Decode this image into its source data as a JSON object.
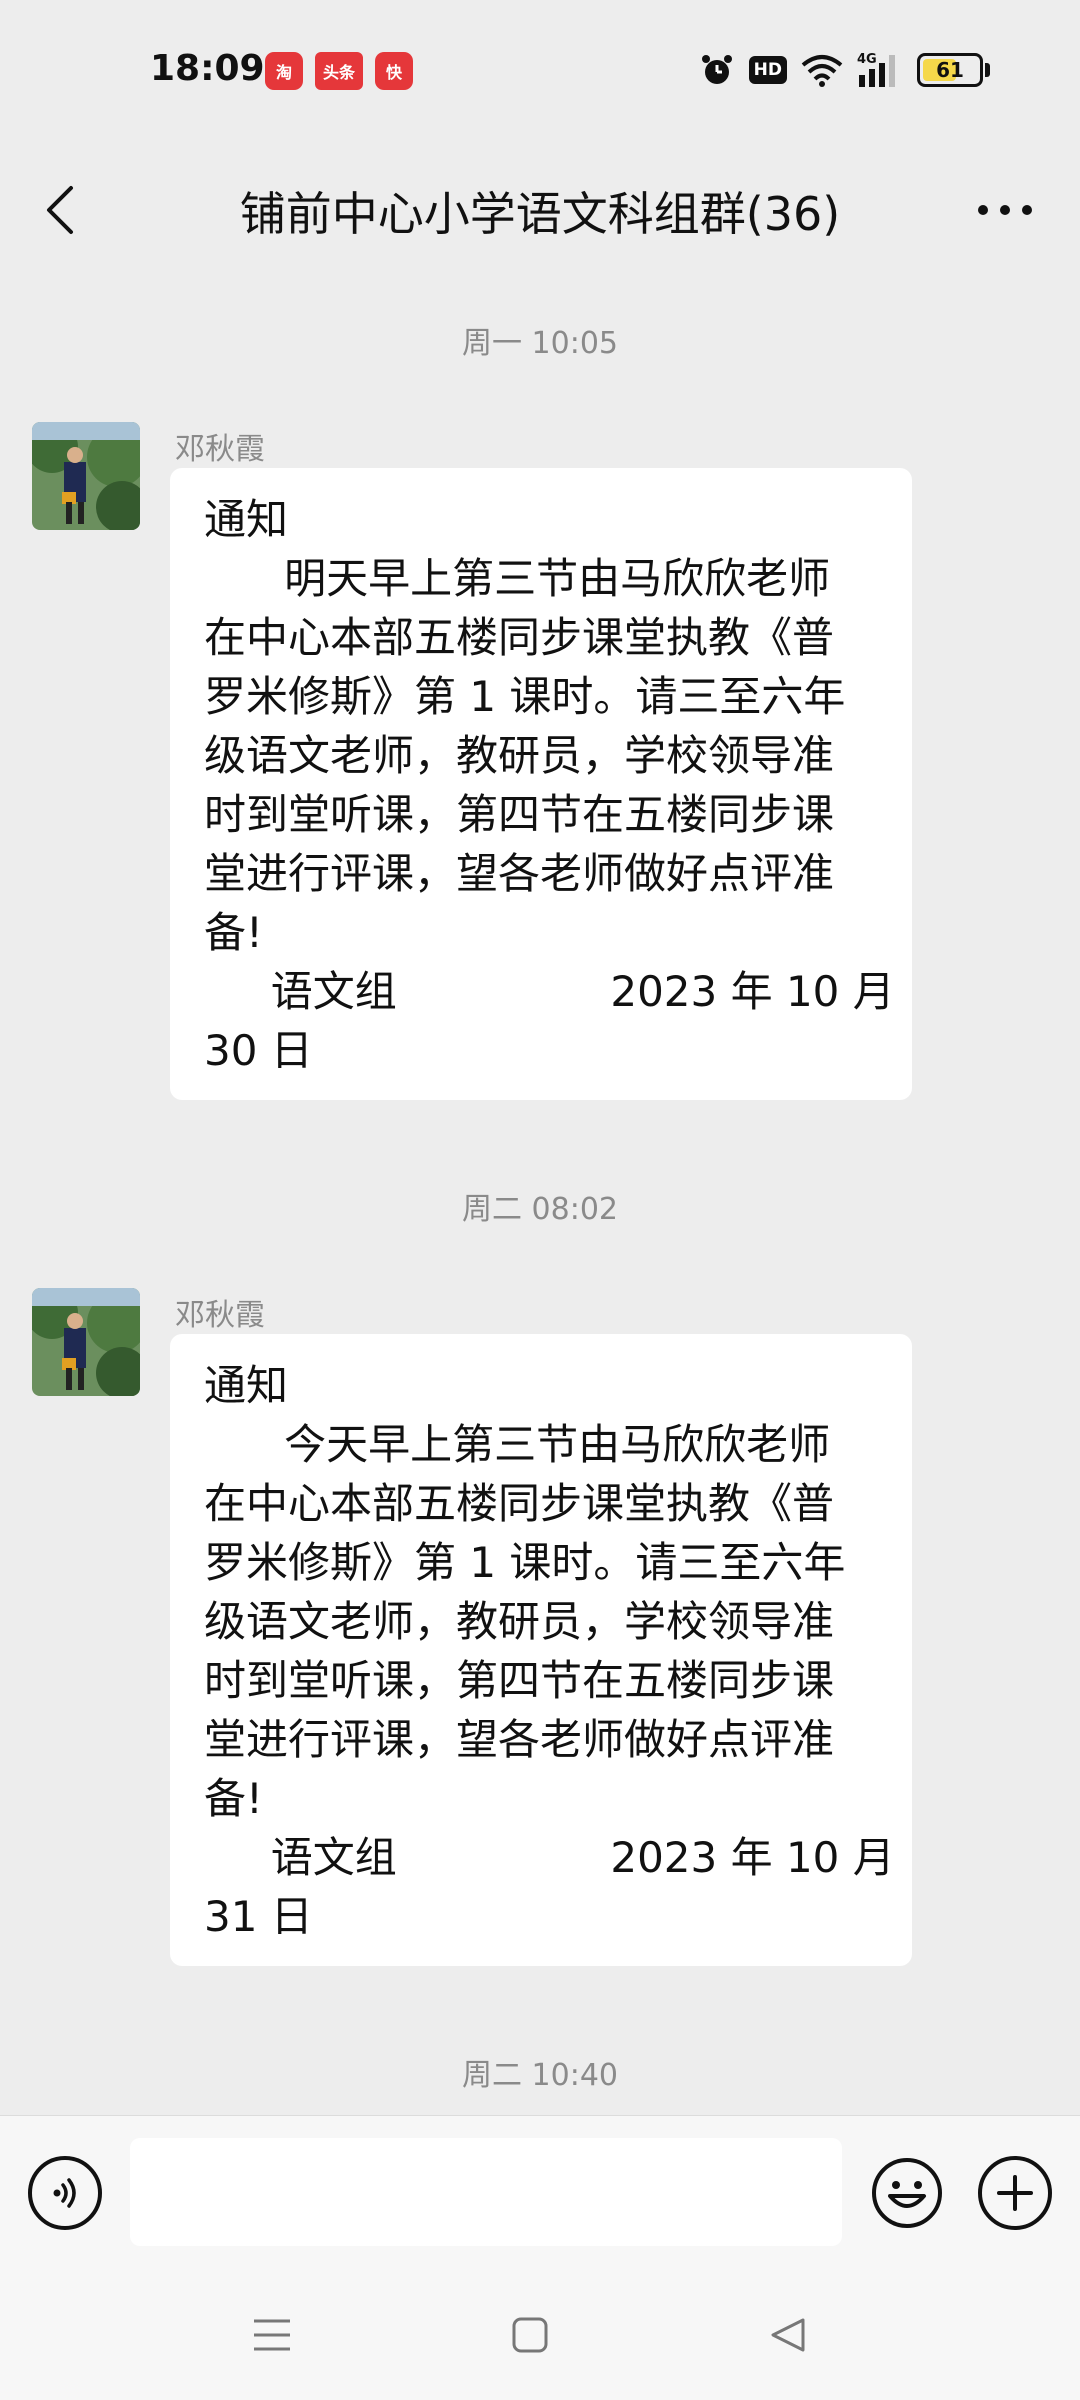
{
  "status_bar": {
    "time": "18:09",
    "apps": [
      {
        "name": "app-taobao-icon",
        "text": "淘"
      },
      {
        "name": "app-toutiao-icon",
        "text": "头条"
      },
      {
        "name": "app-kuaishou-icon",
        "text": "快"
      }
    ],
    "hd": "HD",
    "network": "4G",
    "battery": "61",
    "battery_level": 0.61,
    "battery_color": "#f5d84a"
  },
  "nav": {
    "title": "铺前中心小学语文科组群(36)"
  },
  "chat": {
    "messages": [
      {
        "timestamp": "周一 10:05",
        "sender": "邓秋霞",
        "lines": [
          "通知",
          "      明天早上第三节由马欣欣老师",
          "在中心本部五楼同步课堂执教《普",
          "罗米修斯》第 1 课时。请三至六年",
          "级语文老师，教研员，学校领导准",
          "时到堂听课，第四节在五楼同步课",
          "堂进行评课，望各老师做好点评准",
          "备!",
          "     语文组                2023 年 10 月",
          "30 日"
        ]
      },
      {
        "timestamp": "周二 08:02",
        "sender": "邓秋霞",
        "lines": [
          "通知",
          "      今天早上第三节由马欣欣老师",
          "在中心本部五楼同步课堂执教《普",
          "罗米修斯》第 1 课时。请三至六年",
          "级语文老师，教研员，学校领导准",
          "时到堂听课，第四节在五楼同步课",
          "堂进行评课，望各老师做好点评准",
          "备!",
          "     语文组                2023 年 10 月",
          "31 日"
        ]
      }
    ],
    "last_timestamp": "周二 10:40"
  },
  "input": {
    "value": "",
    "placeholder": ""
  },
  "colors": {
    "background": "#ededed",
    "bubble": "#ffffff",
    "meta_text": "#8a8a8a"
  }
}
